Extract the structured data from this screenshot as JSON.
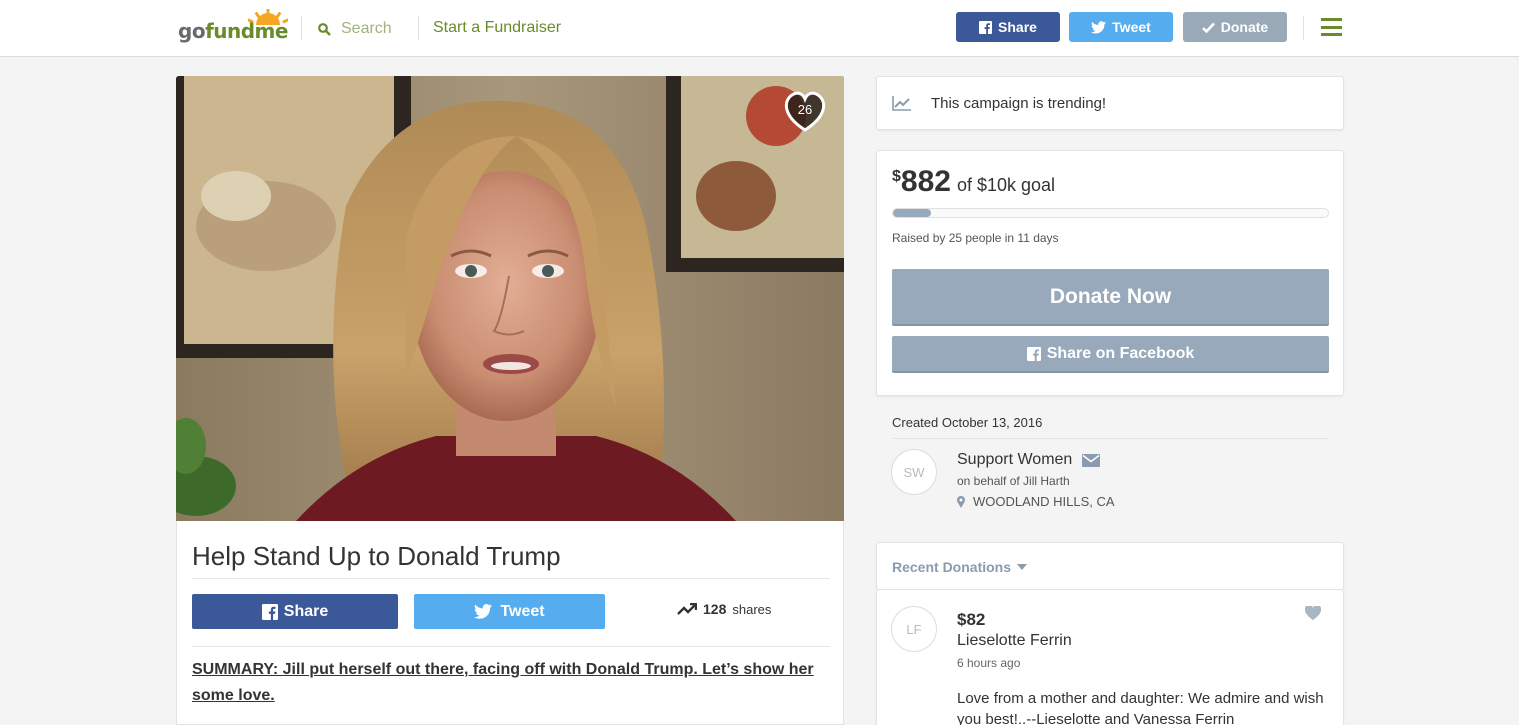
{
  "header": {
    "logo": {
      "go": "go",
      "fundme": "fundme"
    },
    "search_placeholder": "Search",
    "start_label": "Start a Fundraiser",
    "share_label": "Share",
    "tweet_label": "Tweet",
    "donate_label": "Donate"
  },
  "campaign": {
    "likes": "26",
    "title": "Help Stand Up to Donald Trump",
    "share_label": "Share",
    "tweet_label": "Tweet",
    "shares_count": "128",
    "shares_word": "shares",
    "summary": "SUMMARY: Jill put herself out there, facing off with Donald Trump. Let’s show her some love."
  },
  "trending": {
    "text": "This campaign is trending!"
  },
  "goal": {
    "currency": "$",
    "raised": "882",
    "goal_text": "of $10k goal",
    "progress_fraction": 0.088,
    "raised_by": "Raised by 25 people in 11 days",
    "donate_now": "Donate Now",
    "share_facebook": "Share on Facebook"
  },
  "organizer": {
    "created": "Created October 13, 2016",
    "initials": "SW",
    "name": "Support Women",
    "behalf": "on behalf of Jill Harth",
    "location": "WOODLAND HILLS, CA"
  },
  "recent": {
    "label": "Recent Donations",
    "donation": {
      "initials": "LF",
      "amount": "$82",
      "name": "Lieselotte Ferrin",
      "time": "6 hours ago",
      "message": "Love from a mother and daughter: We admire and wish you best!..--Lieselotte and Vanessa Ferrin"
    }
  },
  "colors": {
    "facebook": "#3b5998",
    "twitter": "#55acee",
    "muted_button": "#97a9bb",
    "brand_green": "#6a8b2a"
  }
}
